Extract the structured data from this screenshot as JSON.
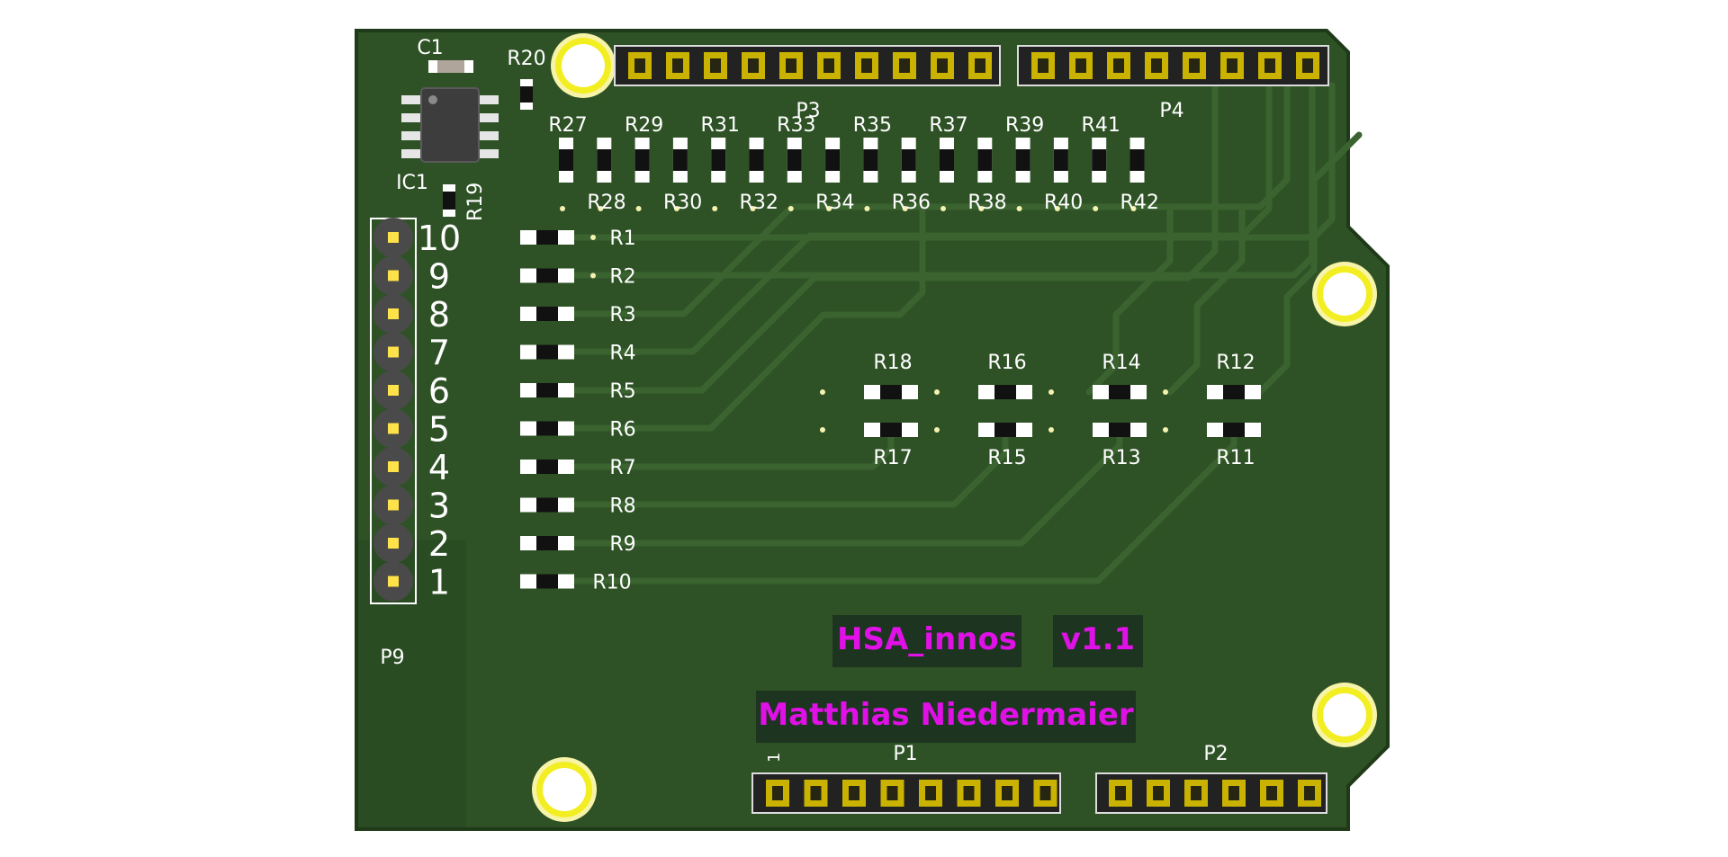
{
  "colors": {
    "background": "#ffffff",
    "board": "#2e5225",
    "board_edge": "#1f3a18",
    "trace": "#3a6330",
    "silkscreen": "#ffffff",
    "copper_pad": "#c9b200",
    "mount_hole": "#f2ee22",
    "text_magenta": "#e011e6",
    "text_box": "#1d3420"
  },
  "board": {
    "silk_texts": [
      "HSA_innos",
      "v1.1",
      "Matthias Niedermaier"
    ],
    "connectors": {
      "p1": "P1",
      "p2": "P2",
      "p3": "P3",
      "p4": "P4",
      "p9": "P9",
      "pin1_marker": "1"
    },
    "ic": {
      "ic1": "IC1",
      "c1": "C1",
      "r19": "R19",
      "r20": "R20"
    },
    "header_pins": [
      "10",
      "9",
      "8",
      "7",
      "6",
      "5",
      "4",
      "3",
      "2",
      "1"
    ],
    "left_resistors": [
      "R1",
      "R2",
      "R3",
      "R4",
      "R5",
      "R6",
      "R7",
      "R8",
      "R9",
      "R10"
    ],
    "top_upper_labels": [
      "R27",
      "R29",
      "R31",
      "R33",
      "R35",
      "R37",
      "R39",
      "R41"
    ],
    "top_lower_labels": [
      "R28",
      "R30",
      "R32",
      "R34",
      "R36",
      "R38",
      "R40",
      "R42"
    ],
    "middle_upper_labels": [
      "R18",
      "R16",
      "R14",
      "R12"
    ],
    "middle_lower_labels": [
      "R17",
      "R15",
      "R13",
      "R11"
    ],
    "pin_counts": {
      "p1": 8,
      "p2": 6,
      "p3": 10,
      "p4": 8
    }
  }
}
